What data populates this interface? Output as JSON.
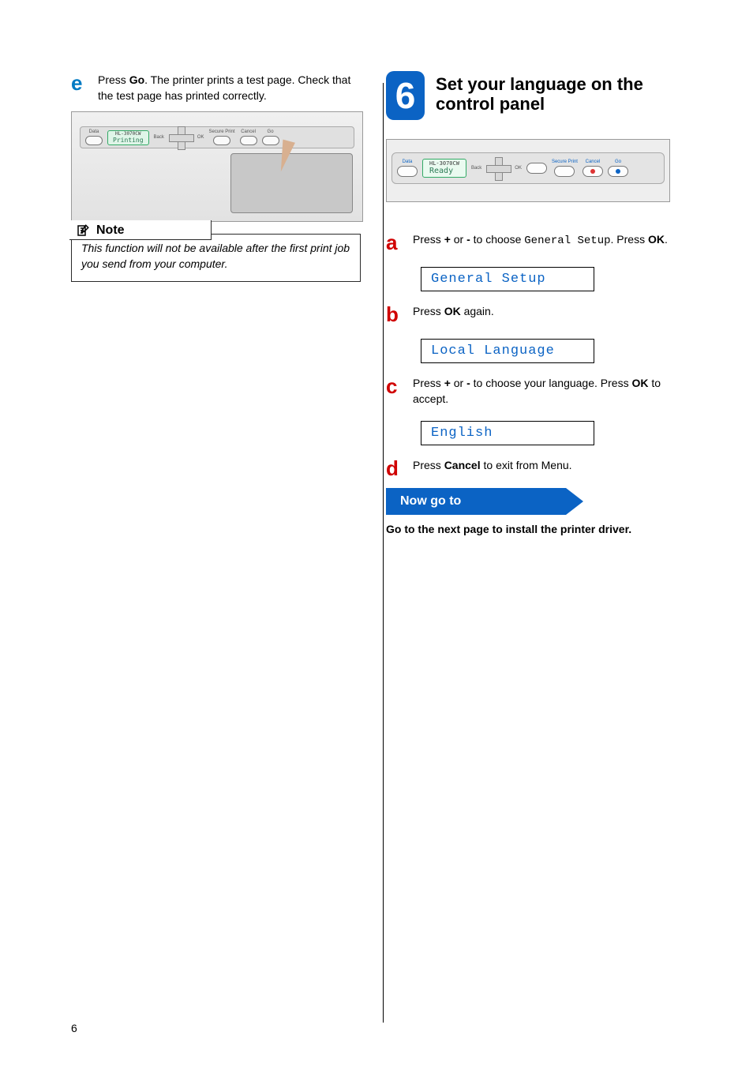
{
  "left": {
    "step_e": {
      "letter": "e",
      "prefix": "Press ",
      "key": "Go",
      "suffix": ". The printer prints a test page. Check that the test page has printed correctly."
    },
    "printer_panel": {
      "model": "HL-3070CW",
      "lcd_text": "Printing",
      "labels": {
        "data": "Data",
        "back": "Back",
        "ok": "OK",
        "secure": "Secure Print",
        "cancel": "Cancel",
        "go": "Go"
      }
    },
    "note": {
      "title": "Note",
      "body": "This function will not be available after the first print job you send from your computer."
    }
  },
  "right": {
    "step_number": "6",
    "step_title": "Set your language on the control panel",
    "panel": {
      "model": "HL-3070CW",
      "lcd_text": "Ready",
      "labels": {
        "data": "Data",
        "back": "Back",
        "ok": "OK",
        "secure": "Secure Print",
        "cancel": "Cancel",
        "go": "Go"
      }
    },
    "steps": {
      "a": {
        "letter": "a",
        "t1": "Press ",
        "plus": "+",
        "t2": " or ",
        "minus": "-",
        "t3": " to choose ",
        "menu": "General Setup",
        "t4": ". Press ",
        "ok": "OK",
        "t5": ".",
        "lcd": "General Setup"
      },
      "b": {
        "letter": "b",
        "t1": "Press ",
        "ok": "OK",
        "t2": " again.",
        "lcd": "Local Language"
      },
      "c": {
        "letter": "c",
        "t1": "Press ",
        "plus": "+",
        "t2": " or ",
        "minus": "-",
        "t3": " to choose your language. Press ",
        "ok": "OK",
        "t4": " to accept.",
        "lcd": "English"
      },
      "d": {
        "letter": "d",
        "t1": "Press ",
        "cancel": "Cancel",
        "t2": " to exit from Menu."
      }
    },
    "now_go_to": "Now go to",
    "after_arrow": "Go to the next page to install the printer driver."
  },
  "page_number": "6"
}
